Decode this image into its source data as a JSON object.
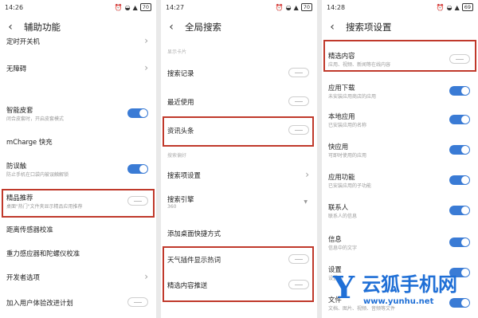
{
  "screen1": {
    "time": "14:26",
    "battery": "70",
    "title": "辅助功能",
    "items": [
      {
        "label": "定时开关机",
        "sub": "",
        "control": "chevron"
      },
      {
        "label": "无障碍",
        "sub": "",
        "control": "chevron"
      },
      {
        "label": "智能皮套",
        "sub": "闭合皮套时，开启皮套模式",
        "control": "on"
      },
      {
        "label": "mCharge 快充",
        "sub": "",
        "control": "none"
      },
      {
        "label": "防误触",
        "sub": "防止手机在口袋内被误触解锁",
        "control": "on"
      },
      {
        "label": "精品推荐",
        "sub": "桌面\"热门\"文件夹显示精品应用推荐",
        "control": "off"
      },
      {
        "label": "距离传感器校准",
        "sub": "",
        "control": "none"
      },
      {
        "label": "重力感应器和陀螺仪校准",
        "sub": "",
        "control": "none"
      },
      {
        "label": "开发者选项",
        "sub": "",
        "control": "chevron"
      },
      {
        "label": "加入用户体验改进计划",
        "sub": "",
        "control": "off"
      }
    ]
  },
  "screen2": {
    "time": "14:27",
    "battery": "70",
    "title": "全局搜索",
    "section1": "显示卡片",
    "section2": "搜索偏好",
    "items": [
      {
        "label": "搜索记录",
        "sub": "",
        "control": "off"
      },
      {
        "label": "最近使用",
        "sub": "",
        "control": "off"
      },
      {
        "label": "资讯头条",
        "sub": "",
        "control": "off"
      },
      {
        "label": "搜索项设置",
        "sub": "",
        "control": "chevron"
      },
      {
        "label": "搜索引擎",
        "sub": "360",
        "control": "caret"
      },
      {
        "label": "添加桌面快捷方式",
        "sub": "",
        "control": "none"
      },
      {
        "label": "天气插件显示热词",
        "sub": "",
        "control": "off"
      },
      {
        "label": "精选内容推送",
        "sub": "",
        "control": "off"
      }
    ]
  },
  "screen3": {
    "time": "14:28",
    "battery": "69",
    "title": "搜索项设置",
    "items": [
      {
        "label": "精选内容",
        "sub": "应用、视频、新闻等在线内容",
        "control": "off"
      },
      {
        "label": "应用下载",
        "sub": "未安装应用商店的应用",
        "control": "on"
      },
      {
        "label": "本地应用",
        "sub": "已安装应用的名称",
        "control": "on"
      },
      {
        "label": "快应用",
        "sub": "可即时使用的应用",
        "control": "on"
      },
      {
        "label": "应用功能",
        "sub": "已安装应用的子功能",
        "control": "on"
      },
      {
        "label": "联系人",
        "sub": "联系人的信息",
        "control": "on"
      },
      {
        "label": "信息",
        "sub": "信息中的文字",
        "control": "on"
      },
      {
        "label": "设置",
        "sub": "设置项",
        "control": "on"
      },
      {
        "label": "文件",
        "sub": "文档、图片、视频、音频等文件",
        "control": "on"
      }
    ]
  },
  "watermark": {
    "logo": "Y",
    "text": "云狐手机网",
    "url": "www.yunhu.net"
  }
}
